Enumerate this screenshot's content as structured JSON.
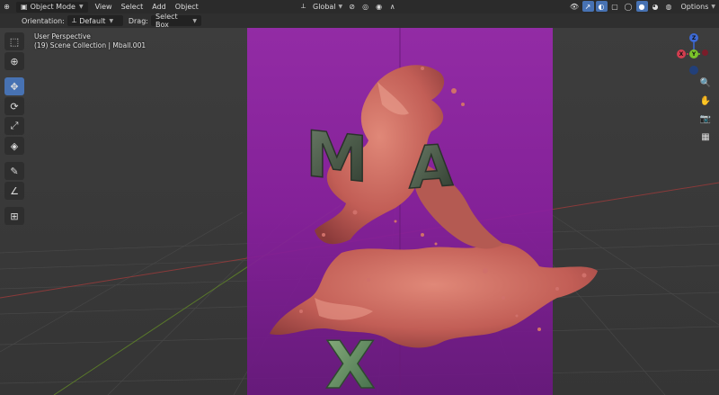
{
  "header": {
    "mode": "Object Mode",
    "menus": [
      "View",
      "Select",
      "Add",
      "Object"
    ],
    "transform_orientation": "Global",
    "options_label": "Options"
  },
  "tool_settings": {
    "orientation_label": "Orientation:",
    "orientation_value": "Default",
    "drag_label": "Drag:",
    "drag_value": "Select Box"
  },
  "viewport": {
    "perspective": "User Perspective",
    "collection": "(19) Scene Collection | Mball.001"
  },
  "gizmo": {
    "z": "Z",
    "y": "Y",
    "x": "X"
  },
  "letters": {
    "m": "M",
    "a": "A",
    "x": "X"
  },
  "colors": {
    "accent": "#4772b3",
    "background": "#3a3a3a",
    "backdrop": "#8a1fa0",
    "splash": "#c9645a"
  },
  "icons": [
    "select-box-icon",
    "cursor-icon",
    "move-icon",
    "rotate-icon",
    "scale-icon",
    "transform-icon",
    "annotate-icon",
    "measure-icon",
    "add-cube-icon",
    "zoom-icon",
    "hand-icon",
    "camera-icon",
    "grid-icon"
  ]
}
